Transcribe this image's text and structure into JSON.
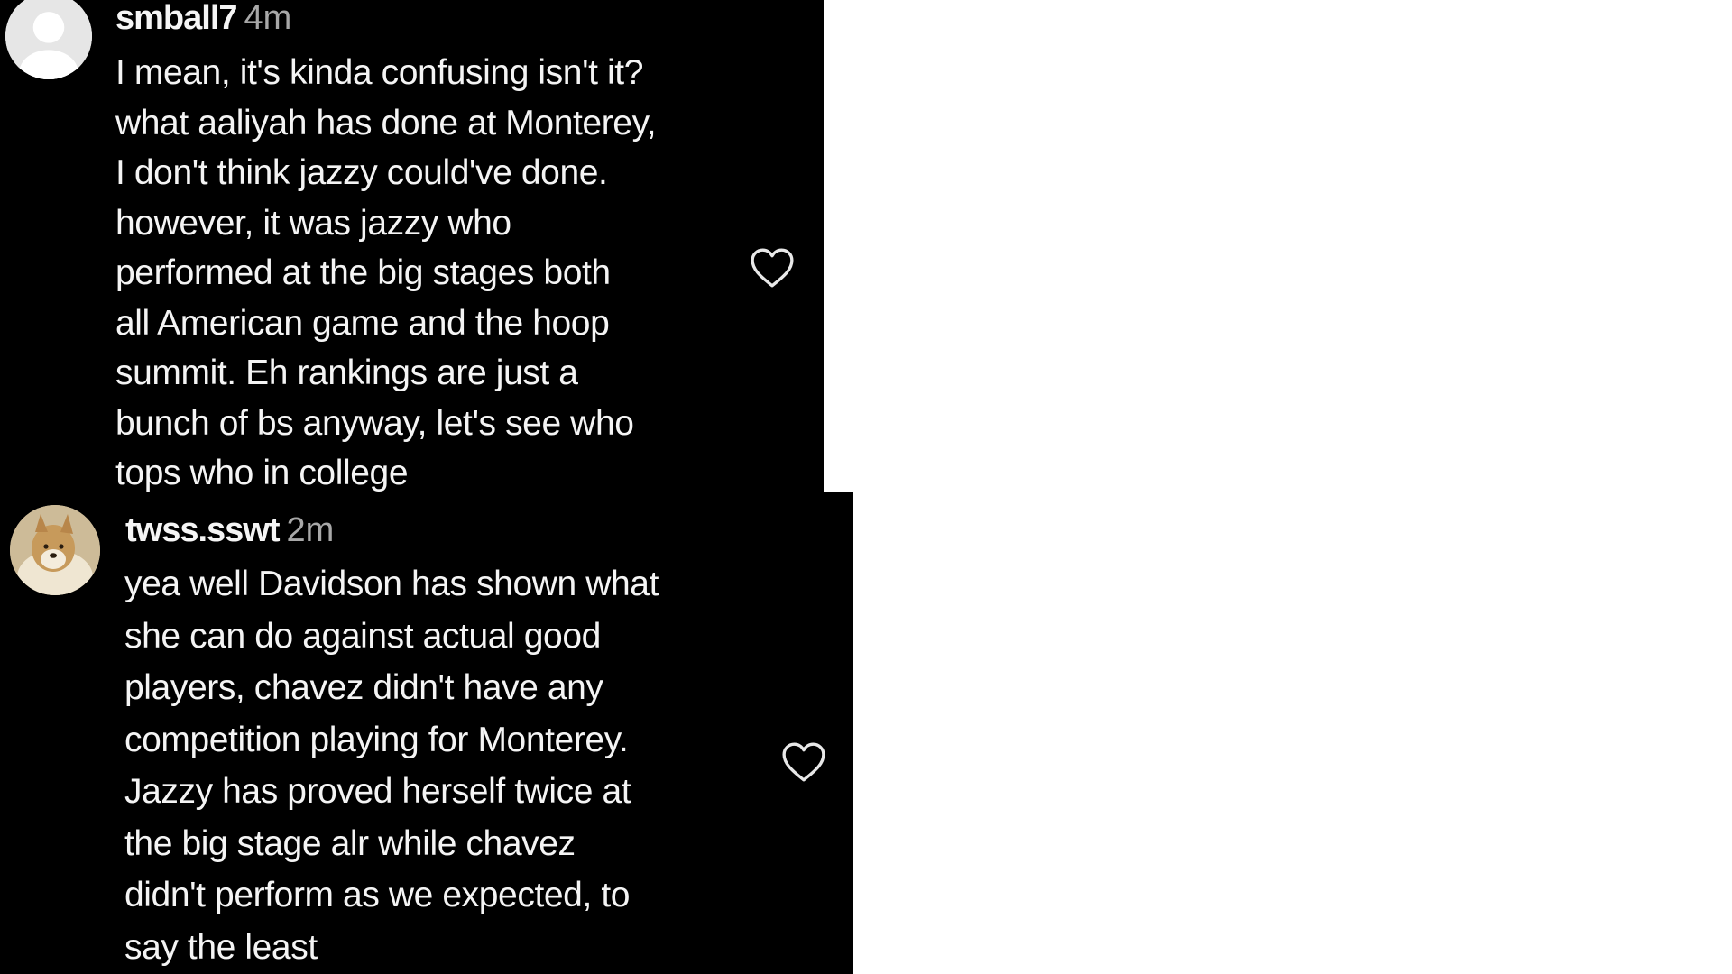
{
  "comments": [
    {
      "username": "smball7",
      "time": "4m",
      "avatar_icon": "default-avatar-icon",
      "text": "I mean, it's kinda confusing isn't it?\nwhat aaliyah has done at Monterey,\nI don't think jazzy could've done.\nhowever, it was jazzy who\nperformed at the big stages both\nall American game and the hoop\nsummit. Eh rankings are just a\nbunch of bs anyway, let's see who\ntops who in college",
      "like_icon": "heart-outline-icon"
    },
    {
      "username": "twss.sswt",
      "time": "2m",
      "avatar_icon": "dog-photo-avatar",
      "text": "yea well Davidson has shown what\nshe can do against actual good\nplayers, chavez didn't have any\ncompetition playing for Monterey.\nJazzy has proved herself twice at\nthe big stage alr while chavez\ndidn't perform as we expected, to\nsay the least",
      "like_icon": "heart-outline-icon"
    }
  ],
  "colors": {
    "card_background": "#000000",
    "page_background": "#ffffff",
    "text": "#f4f4f4",
    "timestamp": "#a8a8a8"
  }
}
